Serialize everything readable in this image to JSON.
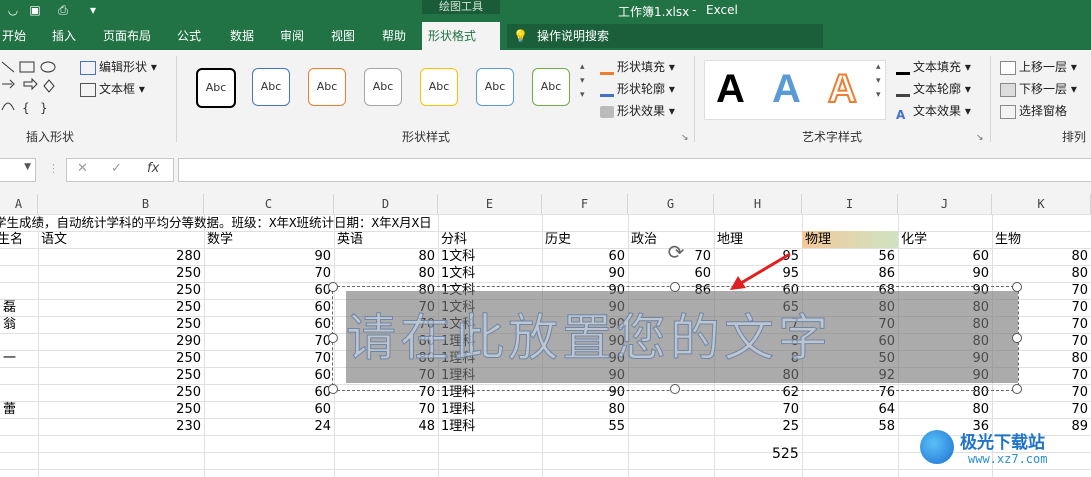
{
  "app": {
    "file_title": "工作簿1.xlsx",
    "app_name": "Excel",
    "separator": "-",
    "contextual_group": "绘图工具"
  },
  "tabs": [
    "开始",
    "插入",
    "页面布局",
    "公式",
    "数据",
    "审阅",
    "视图",
    "帮助",
    "形状格式"
  ],
  "active_tab": "形状格式",
  "search": {
    "label": "操作说明搜索"
  },
  "ribbon": {
    "insert_shapes": {
      "label": "插入形状",
      "edit_shape": "编辑形状",
      "textbox": "文本框"
    },
    "shape_styles": {
      "label": "形状样式",
      "preset_text": "Abc",
      "fill": "形状填充",
      "outline": "形状轮廓",
      "effects": "形状效果",
      "preset_colors": [
        "#000000",
        "#4472c4",
        "#ed7d31",
        "#a5a5a5",
        "#ffc000",
        "#5b9bd5",
        "#70ad47"
      ]
    },
    "wordart": {
      "label": "艺术字样式",
      "letter": "A",
      "text_fill": "文本填充",
      "text_outline": "文本轮廓",
      "text_effects": "文本效果"
    },
    "arrange": {
      "label": "排列",
      "bring_forward": "上移一层",
      "send_backward": "下移一层",
      "selection_pane": "选择窗格"
    }
  },
  "formula_bar": {
    "cancel": "✕",
    "enter": "✓",
    "fx": "fx"
  },
  "grid": {
    "columns": [
      "A",
      "B",
      "C",
      "D",
      "E",
      "F",
      "G",
      "H",
      "I",
      "J",
      "K"
    ],
    "title_row": "学生成绩，自动统计学科的平均分等数据。班级：X年X班统计日期：X年X月X日",
    "headers": [
      "生名",
      "语文",
      "数学",
      "英语",
      "分科",
      "历史",
      "政治",
      "地理",
      "物理",
      "化学",
      "生物"
    ],
    "rows": [
      {
        "a": "",
        "b": "280",
        "c": "90",
        "d": "80",
        "e": "1文科",
        "f": "60",
        "g": "70",
        "h": "95",
        "i": "56",
        "j": "60",
        "k": "80"
      },
      {
        "a": "",
        "b": "250",
        "c": "70",
        "d": "80",
        "e": "1文科",
        "f": "90",
        "g": "60",
        "h": "95",
        "i": "86",
        "j": "90",
        "k": "80"
      },
      {
        "a": "",
        "b": "250",
        "c": "60",
        "d": "80",
        "e": "1文科",
        "f": "90",
        "g": "86",
        "h": "60",
        "i": "68",
        "j": "90",
        "k": "70"
      },
      {
        "a": "磊",
        "b": "250",
        "c": "60",
        "d": "70",
        "e": "1文科",
        "f": "90",
        "g": "",
        "h": "65",
        "i": "80",
        "j": "80",
        "k": "70"
      },
      {
        "a": "翁",
        "b": "250",
        "c": "60",
        "d": "70",
        "e": "1文科",
        "f": "90",
        "g": "",
        "h": "7",
        "i": "70",
        "j": "80",
        "k": "70"
      },
      {
        "a": "",
        "b": "290",
        "c": "70",
        "d": "80",
        "e": "1理科",
        "f": "90",
        "g": "",
        "h": "8",
        "i": "60",
        "j": "80",
        "k": "70"
      },
      {
        "a": "一",
        "b": "250",
        "c": "70",
        "d": "80",
        "e": "1理科",
        "f": "90",
        "g": "",
        "h": "8",
        "i": "50",
        "j": "90",
        "k": "80"
      },
      {
        "a": "",
        "b": "250",
        "c": "60",
        "d": "70",
        "e": "1理科",
        "f": "90",
        "g": "",
        "h": "80",
        "i": "92",
        "j": "90",
        "k": "70"
      },
      {
        "a": "",
        "b": "250",
        "c": "60",
        "d": "70",
        "e": "1理科",
        "f": "90",
        "g": "",
        "h": "62",
        "i": "76",
        "j": "80",
        "k": "70"
      },
      {
        "a": "蕾",
        "b": "250",
        "c": "60",
        "d": "70",
        "e": "1理科",
        "f": "80",
        "g": "",
        "h": "70",
        "i": "64",
        "j": "80",
        "k": "70"
      },
      {
        "a": "",
        "b": "230",
        "c": "24",
        "d": "48",
        "e": "1理科",
        "f": "55",
        "g": "",
        "h": "25",
        "i": "58",
        "j": "36",
        "k": "89"
      }
    ],
    "total_cell": "525"
  },
  "shape": {
    "text": "请在此放置您的文字"
  },
  "watermark": {
    "name": "极光下载站",
    "url": "www.xz7.com"
  }
}
